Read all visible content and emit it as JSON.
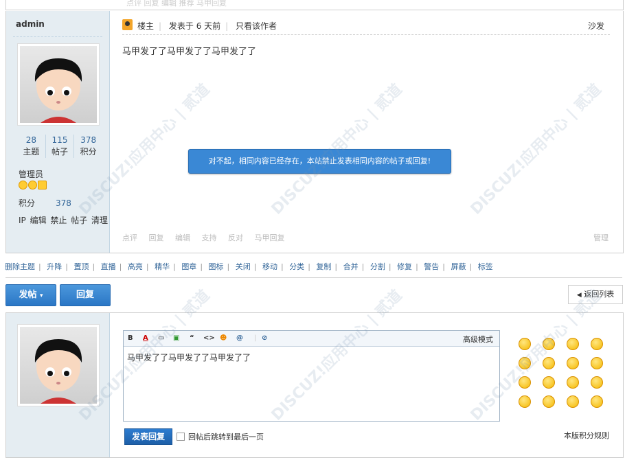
{
  "top_strip": {
    "ghost": "点评   回复   编辑   推荐   马甲回复"
  },
  "post": {
    "author": "admin",
    "stats": [
      {
        "value": "28",
        "label": "主题"
      },
      {
        "value": "115",
        "label": "帖子"
      },
      {
        "value": "378",
        "label": "积分"
      }
    ],
    "group": "管理员",
    "points_label": "积分",
    "points_value": "378",
    "admin_links": "IP 编辑 禁止 帖子 清理",
    "floor": "楼主",
    "posted": "发表于 6 天前",
    "only_author": "只看该作者",
    "floor_name": "沙发",
    "content": "马甲发了了马甲发了了马甲发了了",
    "actions": [
      "点评",
      "回复",
      "编辑",
      "支持",
      "反对",
      "马甲回复"
    ],
    "manage": "管理"
  },
  "toast": "对不起，相同内容已经存在，本站禁止发表相同内容的帖子或回复!",
  "mod_links": [
    "删除主题",
    "升降",
    "置顶",
    "直播",
    "高亮",
    "精华",
    "图章",
    "图标",
    "关闭",
    "移动",
    "分类",
    "复制",
    "合并",
    "分割",
    "修复",
    "警告",
    "屏蔽",
    "标签"
  ],
  "buttons": {
    "new_post": "发帖",
    "reply": "回复",
    "back": "返回列表"
  },
  "editor": {
    "toolbar": [
      "B",
      "A",
      "▭",
      "▣",
      "“",
      "<>",
      "☻",
      "@",
      "|",
      "⊘"
    ],
    "advanced": "高级模式",
    "text": "马甲发了了马甲发了了马甲发了了",
    "submit": "发表回复",
    "jump_label": "回帖后跳转到最后一页",
    "rules": "本版积分规则"
  },
  "smilies_count": 16
}
